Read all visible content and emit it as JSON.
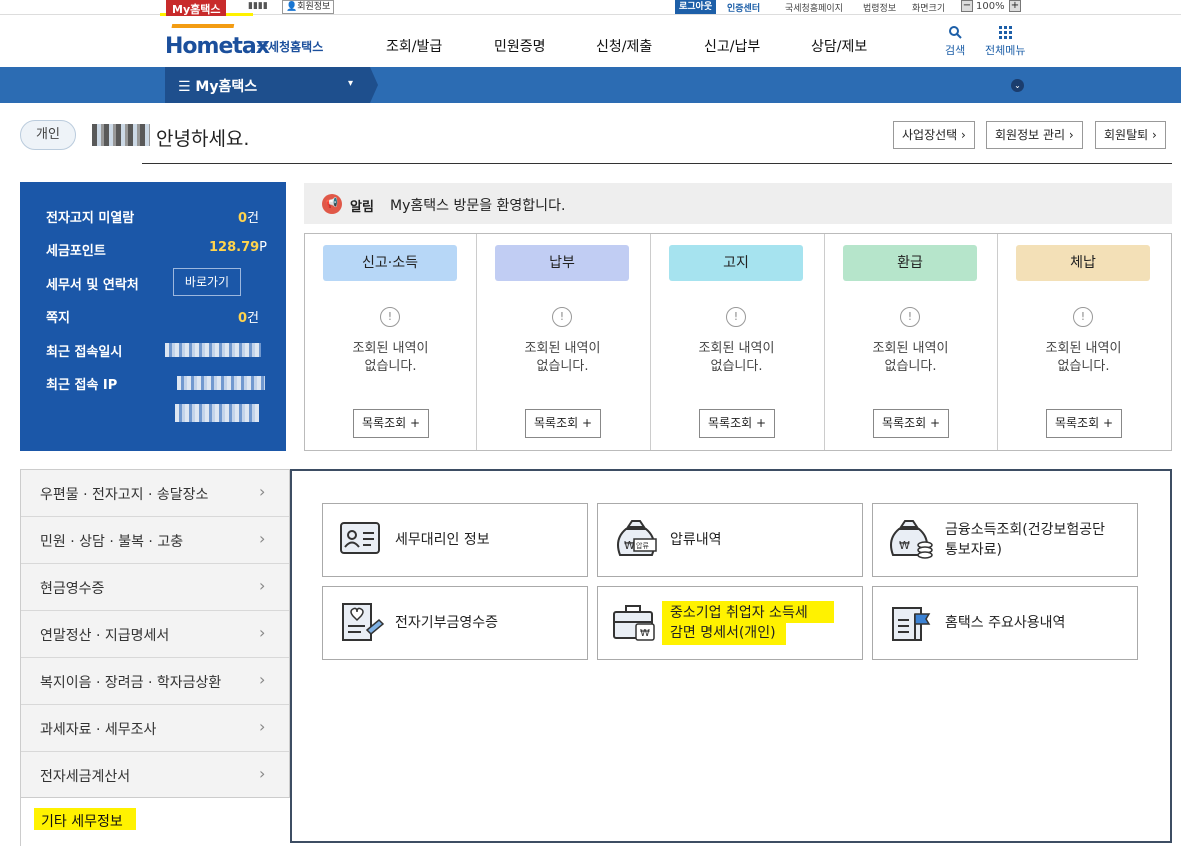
{
  "utility": {
    "my_hometax": "My홈택스",
    "user_masked": "▮▮▮▮",
    "member_info": "회원정보",
    "logout": "로그아웃",
    "cert_center": "인증센터",
    "nts_page": "국세청홈페이지",
    "rules": "법령정보",
    "screen_size": "화면크기",
    "zoom": "100%",
    "zoom_out": "−",
    "zoom_in": "+"
  },
  "header": {
    "logo_en": "Hometax",
    "logo_ko": "국세청홈택스",
    "gnb": [
      "조회/발급",
      "민원증명",
      "신청/제출",
      "신고/납부",
      "상담/제보"
    ],
    "search": "검색",
    "all_menu": "전체메뉴"
  },
  "navbar": {
    "label": "☰  My홈택스",
    "caret": "▾",
    "circle": "⌄"
  },
  "greeting": {
    "chip": "개인",
    "hello": "안녕하세요.",
    "buttons": [
      "사업장선택 ›",
      "회원정보 관리 ›",
      "회원탈퇴 ›"
    ]
  },
  "info": {
    "rows": [
      {
        "label": "전자고지 미열람",
        "value": "0",
        "unit": "건"
      },
      {
        "label": "세금포인트",
        "value": "128.79",
        "unit": "P"
      },
      {
        "label": "세무서 및 연락처",
        "value": "",
        "unit": ""
      },
      {
        "label": "쪽지",
        "value": "0",
        "unit": "건"
      },
      {
        "label": "최근 접속일시",
        "value": "",
        "unit": ""
      },
      {
        "label": "최근 접속 IP",
        "value": "",
        "unit": ""
      }
    ],
    "goto": "바로가기"
  },
  "alert": {
    "title": "알림",
    "message": "My홈택스 방문을 환영합니다."
  },
  "status": {
    "columns": [
      {
        "title": "신고·소득",
        "color": "#b7d7f7"
      },
      {
        "title": "납부",
        "color": "#c1cdf3"
      },
      {
        "title": "고지",
        "color": "#a6e3ef"
      },
      {
        "title": "환급",
        "color": "#b6e5cb"
      },
      {
        "title": "체납",
        "color": "#f3e0b7"
      }
    ],
    "empty_line1": "조회된 내역이",
    "empty_line2": "없습니다.",
    "list_button": "목록조회 +",
    "alert_glyph": "!"
  },
  "menu": {
    "items": [
      "우편물 · 전자고지 · 송달장소",
      "민원 · 상담 · 불복 · 고충",
      "현금영수증",
      "연말정산 · 지급명세서",
      "복지이음 · 장려금 · 학자금상환",
      "과세자료 · 세무조사",
      "전자세금계산서"
    ],
    "chevron": "›",
    "selected": "기타 세무정보"
  },
  "cards": [
    {
      "line1": "세무대리인 정보",
      "line2": "",
      "icon": "id-card-icon"
    },
    {
      "line1": "압류내역",
      "line2": "",
      "icon": "money-bag-seizure-icon"
    },
    {
      "line1": "금융소득조회(건강보험공단",
      "line2": "통보자료)",
      "icon": "money-bag-coins-icon"
    },
    {
      "line1": "전자기부금영수증",
      "line2": "",
      "icon": "donation-receipt-icon"
    },
    {
      "line1": "중소기업 취업자 소득세",
      "line2": "감면 명세서(개인)",
      "icon": "briefcase-won-icon"
    },
    {
      "line1": "홈택스 주요사용내역",
      "line2": "",
      "icon": "document-flag-icon"
    }
  ],
  "icon_labels": {
    "won": "₩",
    "seizure": "압류"
  }
}
